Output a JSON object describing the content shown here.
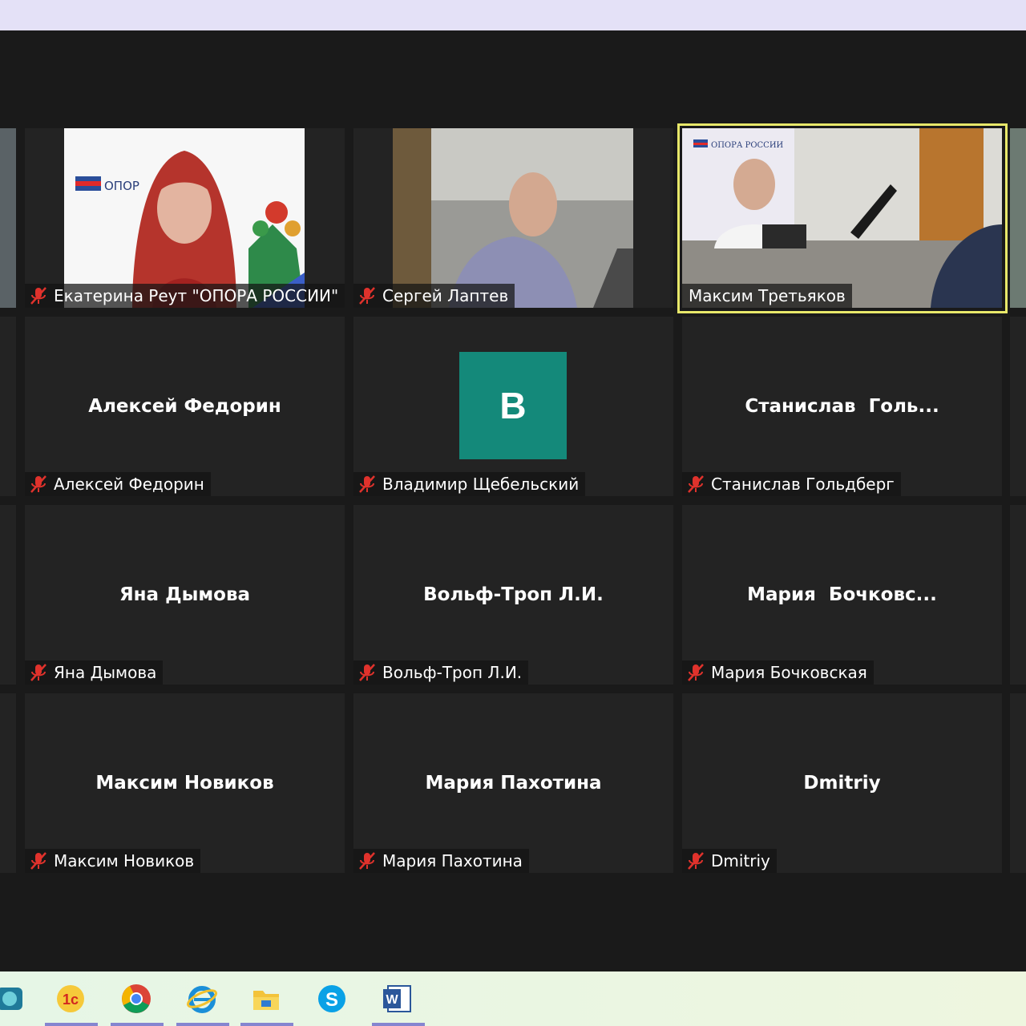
{
  "participants": [
    {
      "id": "reut",
      "display": "Екатерина Реут \"ОПОРА РОССИИ\"",
      "center_name": "",
      "video": true
    },
    {
      "id": "laptev",
      "display": "Сергей Лаптев",
      "center_name": "",
      "video": true
    },
    {
      "id": "tretyakov",
      "display": "Максим Третьяков",
      "center_name": "",
      "video": true,
      "active_speaker": true
    },
    {
      "id": "fedorin",
      "display": "Алексей Федорин",
      "center_name": "Алексей Федорин"
    },
    {
      "id": "shchebelsky",
      "display": "Владимир Щебельский",
      "avatar_letter": "В"
    },
    {
      "id": "goldberg",
      "display": "Станислав Гольдберг",
      "center_name": "Станислав  Голь..."
    },
    {
      "id": "dymova",
      "display": "Яна Дымова",
      "center_name": "Яна Дымова"
    },
    {
      "id": "volftrop",
      "display": "Вольф-Троп Л.И.",
      "center_name": "Вольф-Троп Л.И."
    },
    {
      "id": "bochkovskaya",
      "display": "Мария Бочковская",
      "center_name": "Мария  Бочковс..."
    },
    {
      "id": "novikov",
      "display": "Максим Новиков",
      "center_name": "Максим Новиков"
    },
    {
      "id": "pakhotina",
      "display": "Мария Пахотина",
      "center_name": "Мария Пахотина"
    },
    {
      "id": "dmitriy",
      "display": "Dmitriy",
      "center_name": "Dmitriy"
    }
  ],
  "video_logo_text": {
    "reut": "ОПОР",
    "tretyakov": "ОПОРА РОССИИ"
  },
  "taskbar": {
    "apps": [
      "1c-icon",
      "chrome-icon",
      "ie-icon",
      "file-explorer-icon",
      "skype-icon",
      "word-icon"
    ]
  },
  "colors": {
    "accent_highlight": "#e8e86a",
    "avatar_bg": "#14897a",
    "mic_muted": "#e0322c"
  }
}
